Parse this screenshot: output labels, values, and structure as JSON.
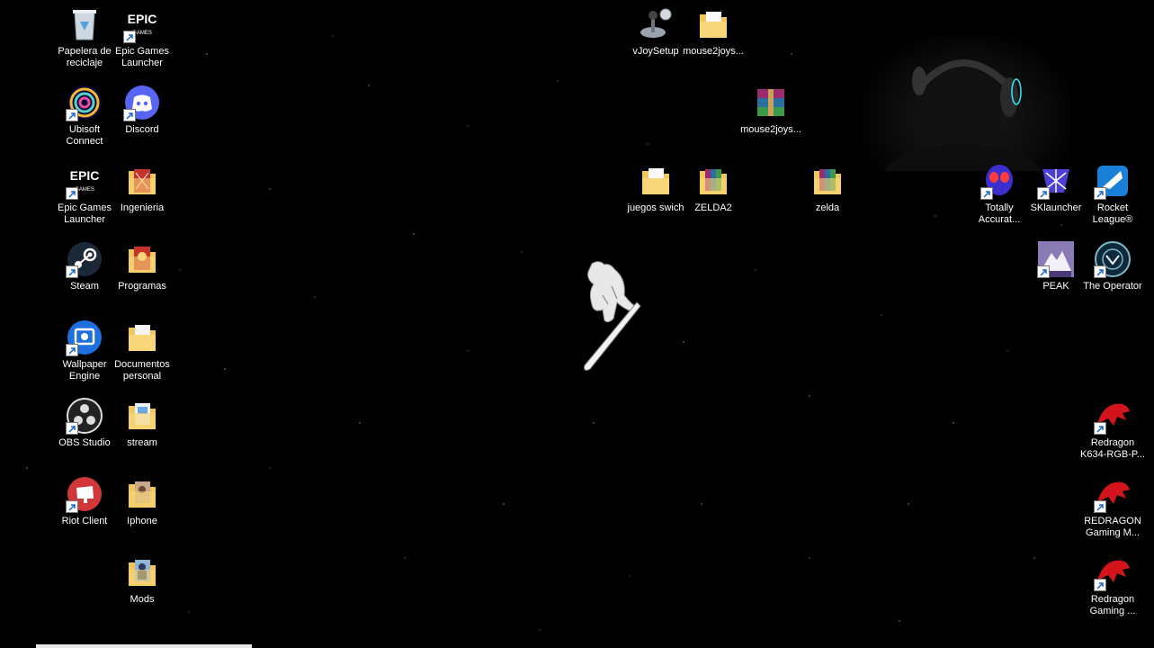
{
  "icons": {
    "recycle_bin": "Papelera de\nreciclaje",
    "epic_games_1": "Epic Games\nLauncher",
    "ubisoft_connect": "Ubisoft\nConnect",
    "discord": "Discord",
    "epic_games_2": "Epic Games\nLauncher",
    "ingenieria": "Ingenieria",
    "steam": "Steam",
    "programas": "Programas",
    "wallpaper_engine": "Wallpaper\nEngine",
    "documentos_personal": "Documentos\npersonal",
    "obs_studio": "OBS Studio",
    "stream": "stream",
    "riot_client": "Riot Client",
    "iphone": "Iphone",
    "mods": "Mods",
    "vjoysetup": "vJoySetup",
    "mouse2joys_folder": "mouse2joys...",
    "mouse2joys_archive": "mouse2joys...",
    "juegos_swich": "juegos swich",
    "zelda2": "ZELDA2",
    "zelda": "zelda",
    "totally_accurate": "Totally\nAccurat...",
    "sklauncher": "SKlauncher",
    "rocket_league": "Rocket\nLeague®",
    "peak": "PEAK",
    "the_operator": "The Operator",
    "redragon_1": "Redragon\nK634-RGB-P...",
    "redragon_2": "REDRAGON\nGaming M...",
    "redragon_3": "Redragon\nGaming ..."
  },
  "icon_types": {
    "folder": "folder-icon",
    "archive": "winrar-archive-icon",
    "shortcut": "shortcut-arrow-icon"
  },
  "colors": {
    "background": "#000000",
    "folder": "#f3c65a",
    "discord": "#5865f2",
    "riot": "#d13639",
    "redragon": "#d4141c",
    "wallpaper_engine": "#1e6fe0",
    "rocket_league": "#1a7fd6"
  }
}
